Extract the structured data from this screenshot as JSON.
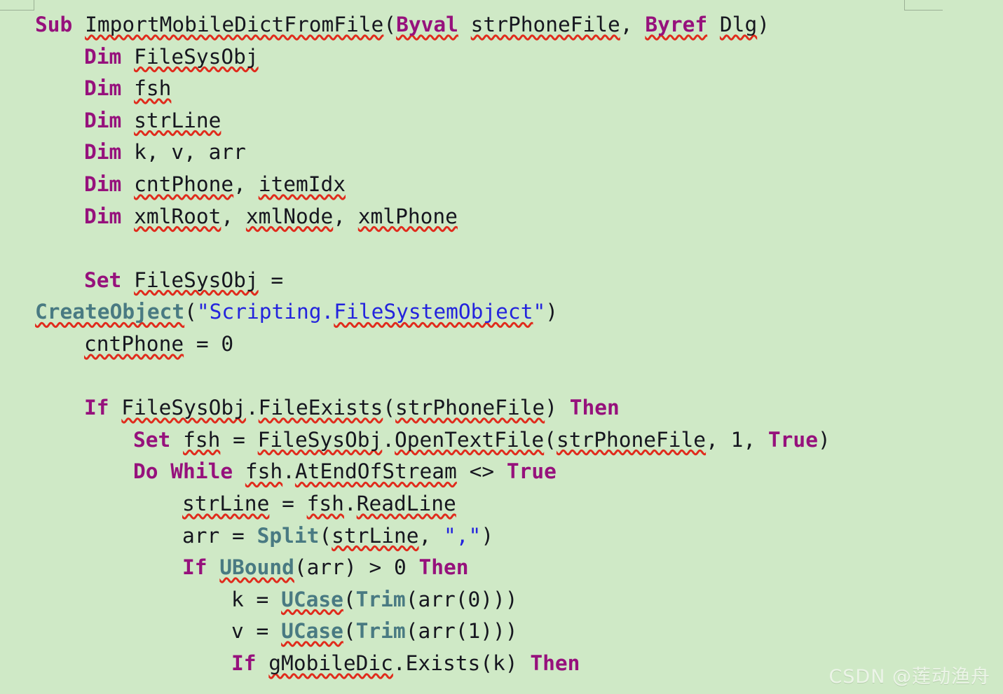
{
  "background_color": "#cfe9c6",
  "theme": {
    "keyword_color": "#96117c",
    "function_color": "#497a82",
    "string_color": "#2323dd",
    "identifier_color": "#16161f",
    "spellcheck_underline_color": "#e02b1c",
    "watermark_color": "#f2f7ef"
  },
  "watermark": {
    "text": "CSDN @莲动渔舟"
  },
  "code": {
    "language": "VBScript",
    "lines": [
      {
        "indent": 0,
        "tokens": [
          {
            "t": "Sub",
            "c": "kw"
          },
          {
            "t": " ",
            "c": "pun"
          },
          {
            "t": "ImportMobileDictFromFile",
            "c": "id",
            "sq": true
          },
          {
            "t": "(",
            "c": "pun"
          },
          {
            "t": "Byval",
            "c": "kw",
            "sq": true
          },
          {
            "t": " ",
            "c": "pun"
          },
          {
            "t": "strPhoneFile",
            "c": "id",
            "sq": true
          },
          {
            "t": ", ",
            "c": "pun"
          },
          {
            "t": "Byref",
            "c": "kw",
            "sq": true
          },
          {
            "t": " ",
            "c": "pun"
          },
          {
            "t": "Dlg",
            "c": "id",
            "sq": true
          },
          {
            "t": ")",
            "c": "pun"
          }
        ]
      },
      {
        "indent": 1,
        "tokens": [
          {
            "t": "Dim",
            "c": "kw"
          },
          {
            "t": " ",
            "c": "pun"
          },
          {
            "t": "FileSysObj",
            "c": "id",
            "sq": true
          }
        ]
      },
      {
        "indent": 1,
        "tokens": [
          {
            "t": "Dim",
            "c": "kw"
          },
          {
            "t": " ",
            "c": "pun"
          },
          {
            "t": "fsh",
            "c": "id",
            "sq": true
          }
        ]
      },
      {
        "indent": 1,
        "tokens": [
          {
            "t": "Dim",
            "c": "kw"
          },
          {
            "t": " ",
            "c": "pun"
          },
          {
            "t": "strLine",
            "c": "id",
            "sq": true
          }
        ]
      },
      {
        "indent": 1,
        "tokens": [
          {
            "t": "Dim",
            "c": "kw"
          },
          {
            "t": " ",
            "c": "pun"
          },
          {
            "t": "k, v, arr",
            "c": "id"
          }
        ]
      },
      {
        "indent": 1,
        "tokens": [
          {
            "t": "Dim",
            "c": "kw"
          },
          {
            "t": " ",
            "c": "pun"
          },
          {
            "t": "cntPhone",
            "c": "id",
            "sq": true
          },
          {
            "t": ", ",
            "c": "pun"
          },
          {
            "t": "itemIdx",
            "c": "id",
            "sq": true
          }
        ]
      },
      {
        "indent": 1,
        "tokens": [
          {
            "t": "Dim",
            "c": "kw"
          },
          {
            "t": " ",
            "c": "pun"
          },
          {
            "t": "xmlRoot",
            "c": "id",
            "sq": true
          },
          {
            "t": ", ",
            "c": "pun"
          },
          {
            "t": "xmlNode",
            "c": "id",
            "sq": true
          },
          {
            "t": ", ",
            "c": "pun"
          },
          {
            "t": "xmlPhone",
            "c": "id",
            "sq": true
          }
        ]
      },
      {
        "indent": 0,
        "tokens": []
      },
      {
        "indent": 1,
        "tokens": [
          {
            "t": "Set",
            "c": "kw"
          },
          {
            "t": " ",
            "c": "pun"
          },
          {
            "t": "FileSysObj",
            "c": "id",
            "sq": true
          },
          {
            "t": " = ",
            "c": "pun"
          }
        ]
      },
      {
        "indent": 0,
        "tokens": [
          {
            "t": "CreateObject",
            "c": "fn",
            "sq": true
          },
          {
            "t": "(",
            "c": "pun"
          },
          {
            "t": "\"",
            "c": "str"
          },
          {
            "t": "Scripting.",
            "c": "str"
          },
          {
            "t": "FileSystemObject",
            "c": "str",
            "sq": true
          },
          {
            "t": "\"",
            "c": "str"
          },
          {
            "t": ")",
            "c": "pun"
          }
        ]
      },
      {
        "indent": 1,
        "tokens": [
          {
            "t": "cntPhone",
            "c": "id",
            "sq": true
          },
          {
            "t": " = ",
            "c": "pun"
          },
          {
            "t": "0",
            "c": "num"
          }
        ]
      },
      {
        "indent": 0,
        "tokens": []
      },
      {
        "indent": 1,
        "tokens": [
          {
            "t": "If",
            "c": "kw"
          },
          {
            "t": " ",
            "c": "pun"
          },
          {
            "t": "FileSysObj",
            "c": "id",
            "sq": true
          },
          {
            "t": ".",
            "c": "pun"
          },
          {
            "t": "FileExists",
            "c": "id",
            "sq": true
          },
          {
            "t": "(",
            "c": "pun"
          },
          {
            "t": "strPhoneFile",
            "c": "id",
            "sq": true
          },
          {
            "t": ") ",
            "c": "pun"
          },
          {
            "t": "Then",
            "c": "kw"
          }
        ]
      },
      {
        "indent": 2,
        "tokens": [
          {
            "t": "Set",
            "c": "kw"
          },
          {
            "t": " ",
            "c": "pun"
          },
          {
            "t": "fsh",
            "c": "id",
            "sq": true
          },
          {
            "t": " = ",
            "c": "pun"
          },
          {
            "t": "FileSysObj",
            "c": "id",
            "sq": true
          },
          {
            "t": ".",
            "c": "pun"
          },
          {
            "t": "OpenTextFile",
            "c": "id",
            "sq": true
          },
          {
            "t": "(",
            "c": "pun"
          },
          {
            "t": "strPhoneFile",
            "c": "id",
            "sq": true
          },
          {
            "t": ", ",
            "c": "pun"
          },
          {
            "t": "1",
            "c": "num"
          },
          {
            "t": ", ",
            "c": "pun"
          },
          {
            "t": "True",
            "c": "kw"
          },
          {
            "t": ")",
            "c": "pun"
          }
        ]
      },
      {
        "indent": 2,
        "tokens": [
          {
            "t": "Do While",
            "c": "kw"
          },
          {
            "t": " ",
            "c": "pun"
          },
          {
            "t": "fsh",
            "c": "id",
            "sq": true
          },
          {
            "t": ".",
            "c": "pun"
          },
          {
            "t": "AtEndOfStream",
            "c": "id",
            "sq": true
          },
          {
            "t": " <> ",
            "c": "pun"
          },
          {
            "t": "True",
            "c": "kw"
          }
        ]
      },
      {
        "indent": 3,
        "tokens": [
          {
            "t": "strLine",
            "c": "id",
            "sq": true
          },
          {
            "t": " = ",
            "c": "pun"
          },
          {
            "t": "fsh",
            "c": "id",
            "sq": true
          },
          {
            "t": ".",
            "c": "pun"
          },
          {
            "t": "ReadLine",
            "c": "id",
            "sq": true
          }
        ]
      },
      {
        "indent": 3,
        "tokens": [
          {
            "t": "arr",
            "c": "id"
          },
          {
            "t": " = ",
            "c": "pun"
          },
          {
            "t": "Split",
            "c": "fn"
          },
          {
            "t": "(",
            "c": "pun"
          },
          {
            "t": "strLine",
            "c": "id",
            "sq": true
          },
          {
            "t": ", ",
            "c": "pun"
          },
          {
            "t": "\",\"",
            "c": "str"
          },
          {
            "t": ")",
            "c": "pun"
          }
        ]
      },
      {
        "indent": 3,
        "tokens": [
          {
            "t": "If",
            "c": "kw"
          },
          {
            "t": " ",
            "c": "pun"
          },
          {
            "t": "UBound",
            "c": "fn",
            "sq": true
          },
          {
            "t": "(",
            "c": "pun"
          },
          {
            "t": "arr",
            "c": "id"
          },
          {
            "t": ") > ",
            "c": "pun"
          },
          {
            "t": "0",
            "c": "num"
          },
          {
            "t": " ",
            "c": "pun"
          },
          {
            "t": "Then",
            "c": "kw"
          }
        ]
      },
      {
        "indent": 4,
        "tokens": [
          {
            "t": "k",
            "c": "id"
          },
          {
            "t": " = ",
            "c": "pun"
          },
          {
            "t": "UCase",
            "c": "fn",
            "sq": true
          },
          {
            "t": "(",
            "c": "pun"
          },
          {
            "t": "Trim",
            "c": "fn"
          },
          {
            "t": "(",
            "c": "pun"
          },
          {
            "t": "arr",
            "c": "id"
          },
          {
            "t": "(",
            "c": "pun"
          },
          {
            "t": "0",
            "c": "num"
          },
          {
            "t": ")))",
            "c": "pun"
          }
        ]
      },
      {
        "indent": 4,
        "tokens": [
          {
            "t": "v",
            "c": "id"
          },
          {
            "t": " = ",
            "c": "pun"
          },
          {
            "t": "UCase",
            "c": "fn",
            "sq": true
          },
          {
            "t": "(",
            "c": "pun"
          },
          {
            "t": "Trim",
            "c": "fn"
          },
          {
            "t": "(",
            "c": "pun"
          },
          {
            "t": "arr",
            "c": "id"
          },
          {
            "t": "(",
            "c": "pun"
          },
          {
            "t": "1",
            "c": "num"
          },
          {
            "t": ")))",
            "c": "pun"
          }
        ]
      },
      {
        "indent": 4,
        "tokens": [
          {
            "t": "If",
            "c": "kw"
          },
          {
            "t": " ",
            "c": "pun"
          },
          {
            "t": "gMobileDic",
            "c": "id",
            "sq": true
          },
          {
            "t": ".",
            "c": "pun"
          },
          {
            "t": "Exists",
            "c": "id"
          },
          {
            "t": "(",
            "c": "pun"
          },
          {
            "t": "k",
            "c": "id"
          },
          {
            "t": ") ",
            "c": "pun"
          },
          {
            "t": "Then",
            "c": "kw"
          }
        ]
      }
    ]
  }
}
